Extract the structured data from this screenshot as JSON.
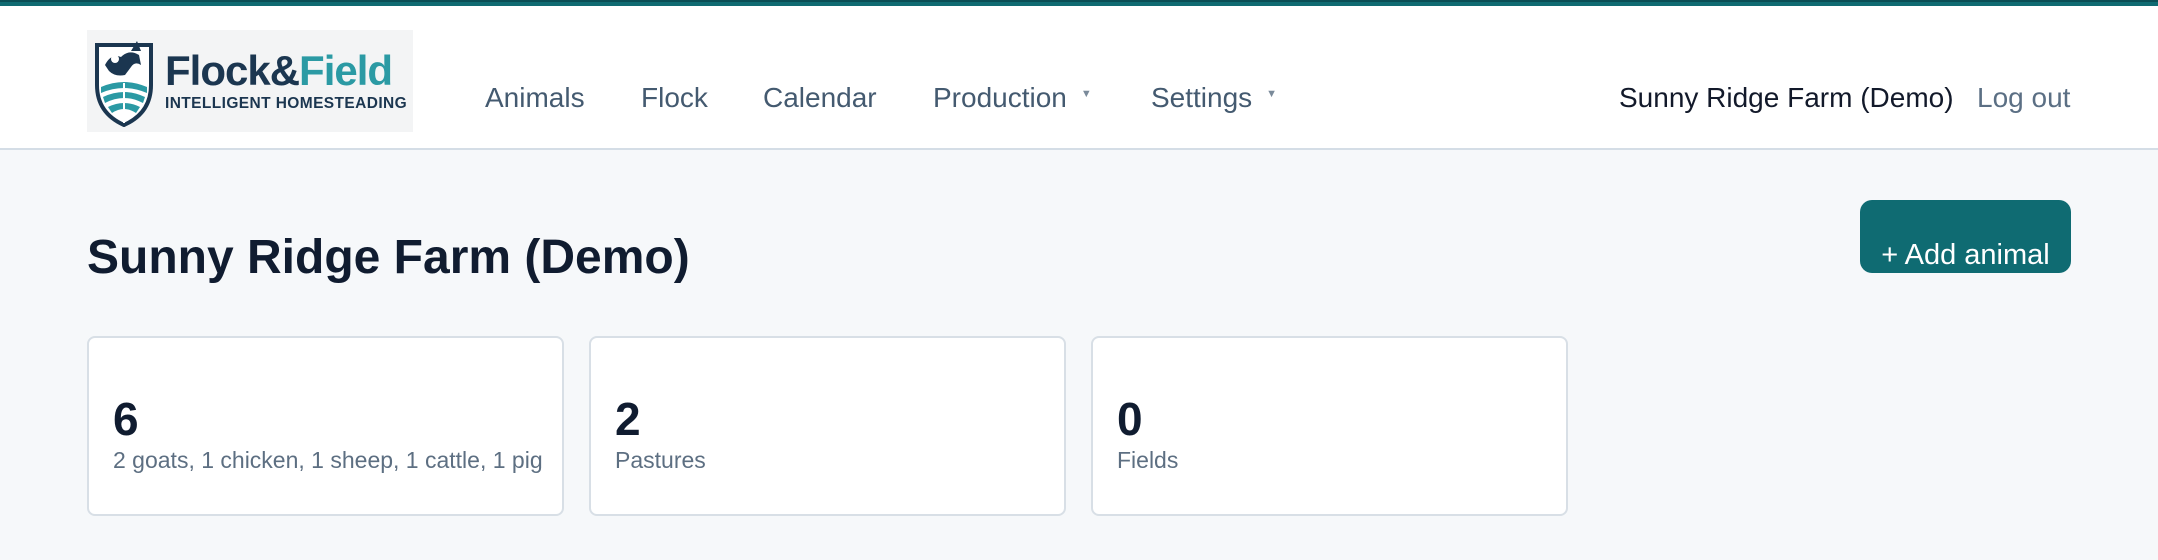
{
  "brand": {
    "word_flock": "Flock",
    "word_amp": "&",
    "word_field": "Field",
    "tagline": "INTELLIGENT HOMESTEADING",
    "colors": {
      "primary": "#0f6b72",
      "navy": "#1b3650",
      "teal": "#2b9aa4"
    }
  },
  "nav": {
    "items": [
      {
        "label": "Animals"
      },
      {
        "label": "Flock"
      },
      {
        "label": "Calendar"
      },
      {
        "label": "Production",
        "caret": "▼"
      },
      {
        "label": "Settings",
        "caret": "▼"
      }
    ],
    "farm_name": "Sunny Ridge Farm (Demo)",
    "logout": "Log out"
  },
  "main": {
    "title": "Sunny Ridge Farm (Demo)",
    "add_button": "+ Add animal",
    "stats": [
      {
        "value": "6",
        "label": "2 goats, 1 chicken, 1 sheep, 1 cattle, 1 pig"
      },
      {
        "value": "2",
        "label": "Pastures"
      },
      {
        "value": "0",
        "label": "Fields"
      }
    ]
  }
}
